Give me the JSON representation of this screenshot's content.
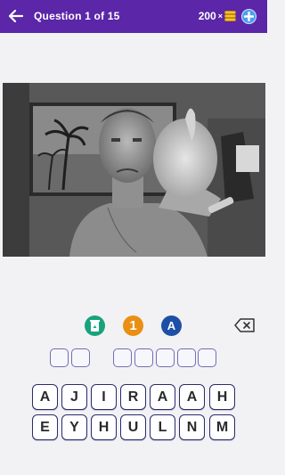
{
  "header": {
    "title": "Question 1 of 15",
    "coins": "200",
    "multiply": "×"
  },
  "hints": {
    "remove_icon": "recycle-icon",
    "reveal_label": "1",
    "letter_label": "A"
  },
  "answer": {
    "word_lengths": [
      2,
      5
    ]
  },
  "keyboard": {
    "row1": [
      "A",
      "J",
      "I",
      "R",
      "A",
      "A",
      "H"
    ],
    "row2": [
      "E",
      "Y",
      "H",
      "U",
      "L",
      "N",
      "M"
    ]
  },
  "colors": {
    "header": "#5b26a8",
    "hint_remove": "#18a37c",
    "hint_reveal": "#e98f13",
    "hint_letter": "#1e4fa6",
    "key_border": "#2b2b6e",
    "slot_border": "#6f6fb8"
  }
}
